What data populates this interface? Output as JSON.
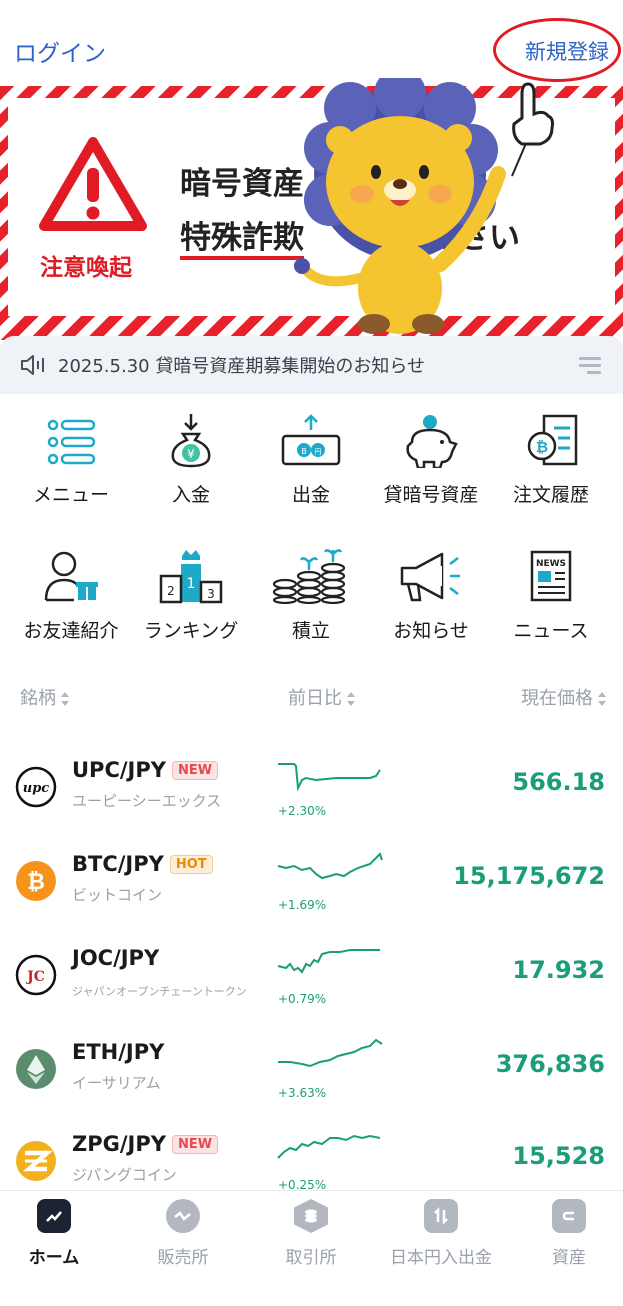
{
  "header": {
    "login": "ログイン",
    "signup": "新規登録"
  },
  "banner": {
    "warning_label": "注意喚起",
    "line1": "暗号資産",
    "line2_highlight": "特殊詐欺",
    "line2_rest": "ください",
    "accent_color": "#e01b24"
  },
  "notice": {
    "text": "2025.5.30 貸暗号資産期募集開始のお知らせ"
  },
  "grid": [
    {
      "label": "メニュー",
      "icon": "menu-list-icon"
    },
    {
      "label": "入金",
      "icon": "deposit-bag-icon"
    },
    {
      "label": "出金",
      "icon": "withdraw-bill-icon"
    },
    {
      "label": "貸暗号資産",
      "icon": "piggy-bank-icon"
    },
    {
      "label": "注文履歴",
      "icon": "order-history-icon"
    },
    {
      "label": "お友達紹介",
      "icon": "invite-friend-icon"
    },
    {
      "label": "ランキング",
      "icon": "ranking-podium-icon"
    },
    {
      "label": "積立",
      "icon": "coin-stack-icon"
    },
    {
      "label": "お知らせ",
      "icon": "megaphone-icon"
    },
    {
      "label": "ニュース",
      "icon": "newspaper-icon"
    }
  ],
  "table": {
    "col_name": "銘柄",
    "col_change": "前日比",
    "col_price": "現在価格"
  },
  "coins": [
    {
      "pair": "UPC/JPY",
      "badge": "NEW",
      "badge_type": "new",
      "name": "ユーピーシーエックス",
      "change": "+2.30%",
      "price": "566.18",
      "icon_color": "#ffffff"
    },
    {
      "pair": "BTC/JPY",
      "badge": "HOT",
      "badge_type": "hot",
      "name": "ビットコイン",
      "change": "+1.69%",
      "price": "15,175,672",
      "icon_color": "#f7931a"
    },
    {
      "pair": "JOC/JPY",
      "badge": "",
      "badge_type": "",
      "name": "ジャパンオープンチェーントークン",
      "change": "+0.79%",
      "price": "17.932",
      "icon_color": "#ffffff"
    },
    {
      "pair": "ETH/JPY",
      "badge": "",
      "badge_type": "",
      "name": "イーサリアム",
      "change": "+3.63%",
      "price": "376,836",
      "icon_color": "#5b8c6e"
    },
    {
      "pair": "ZPG/JPY",
      "badge": "NEW",
      "badge_type": "new",
      "name": "ジパングコイン",
      "change": "+0.25%",
      "price": "15,528",
      "icon_color": "#f2b11c"
    }
  ],
  "nav": [
    {
      "label": "ホーム",
      "icon": "home-chart-icon",
      "active": true
    },
    {
      "label": "販売所",
      "icon": "exchange-wave-icon",
      "active": false
    },
    {
      "label": "取引所",
      "icon": "coin-hex-icon",
      "active": false
    },
    {
      "label": "日本円入出金",
      "icon": "transfer-arrows-icon",
      "active": false
    },
    {
      "label": "資産",
      "icon": "wallet-icon",
      "active": false
    }
  ],
  "colors": {
    "link": "#2e64c8",
    "up": "#1a9e7a",
    "muted": "#9aa1ab"
  }
}
